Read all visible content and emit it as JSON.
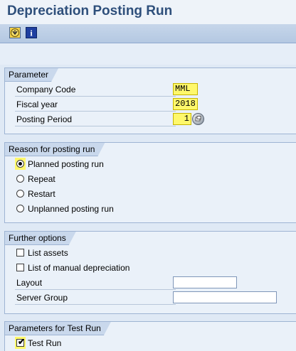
{
  "header": {
    "title": "Depreciation Posting Run",
    "colors": {
      "title": "#2e4f7b",
      "required_field": "#fff86b"
    }
  },
  "toolbar": {
    "execute_icon": "execute-icon",
    "info_icon": "info-icon",
    "info_glyph": "i"
  },
  "parameter": {
    "heading": "Parameter",
    "company_code_label": "Company Code",
    "company_code_value": "MML",
    "fiscal_year_label": "Fiscal year",
    "fiscal_year_value": "2018",
    "posting_period_label": "Posting Period",
    "posting_period_value": "1"
  },
  "reason": {
    "heading": "Reason for posting run",
    "options": [
      {
        "label": "Planned posting run",
        "selected": true
      },
      {
        "label": "Repeat",
        "selected": false
      },
      {
        "label": "Restart",
        "selected": false
      },
      {
        "label": "Unplanned posting run",
        "selected": false
      }
    ]
  },
  "further": {
    "heading": "Further options",
    "list_assets_label": "List assets",
    "list_assets_checked": false,
    "manual_dep_label": "List of manual depreciation",
    "manual_dep_checked": false,
    "layout_label": "Layout",
    "layout_value": "",
    "server_group_label": "Server Group",
    "server_group_value": ""
  },
  "test_run": {
    "heading": "Parameters for Test Run",
    "label": "Test Run",
    "checked": true,
    "check_glyph": "✔"
  }
}
